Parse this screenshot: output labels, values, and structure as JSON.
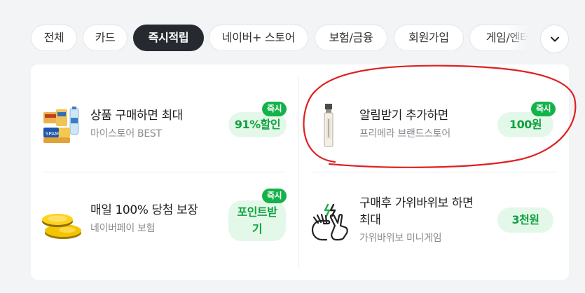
{
  "tabs": [
    {
      "label": "전체",
      "active": false
    },
    {
      "label": "카드",
      "active": false
    },
    {
      "label": "즉시적립",
      "active": true
    },
    {
      "label": "네이버+ 스토어",
      "active": false
    },
    {
      "label": "보험/금융",
      "active": false
    },
    {
      "label": "회원가입",
      "active": false
    },
    {
      "label": "게임/엔터",
      "active": false
    }
  ],
  "more_icon": "chevron-down-icon",
  "items": [
    {
      "title_lines": [
        "상품 구매하면 최대"
      ],
      "subtitle": "마이스토어 BEST",
      "reward": "91%할인",
      "badge": "즉시",
      "thumb": "grocery-products-image"
    },
    {
      "title_lines": [
        "알림받기 추가하면"
      ],
      "subtitle": "프리메라 브랜드스토어",
      "reward": "100원",
      "badge": "즉시",
      "thumb": "cosmetic-bottle-image"
    },
    {
      "title_lines": [
        "매일 100% 당첨 보장"
      ],
      "subtitle": "네이버페이 보험",
      "reward_lines": [
        "포인트받",
        "기"
      ],
      "badge": "즉시",
      "thumb": "gold-coins-image"
    },
    {
      "title_lines": [
        "구매후 가위바위보 하면",
        "최대"
      ],
      "subtitle": "가위바위보 미니게임",
      "reward": "3천원",
      "badge": "",
      "thumb": "rock-paper-scissors-icon"
    }
  ],
  "colors": {
    "accent_green": "#14b34a",
    "reward_text": "#10a23f",
    "reward_bg": "#e4f8ea",
    "annotation": "#e02020",
    "active_chip": "#262a30"
  }
}
